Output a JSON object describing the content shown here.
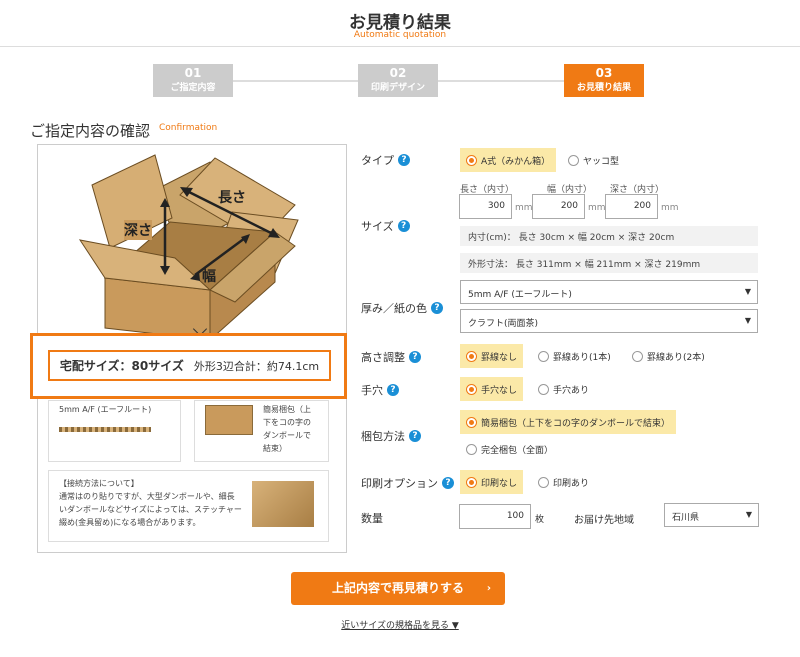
{
  "header": {
    "title": "お見積り結果",
    "subtitle": "Automatic quotation"
  },
  "steps": [
    {
      "num": "01",
      "label": "ご指定内容"
    },
    {
      "num": "02",
      "label": "印刷デザイン"
    },
    {
      "num": "03",
      "label": "お見積り結果"
    }
  ],
  "section": {
    "title": "ご指定内容の確認",
    "subtitle": "Confirmation"
  },
  "diagram": {
    "length": "長さ",
    "depth": "深さ",
    "width": "幅"
  },
  "summary": {
    "size_label": "宅配サイズ：80サイズ",
    "total_label": "外形3辺合計：約74.1cm"
  },
  "cards": {
    "flute": "5mm A/F (エーフルート)",
    "pack_desc": [
      "簡易梱包（上",
      "下をコの字の",
      "ダンボールで",
      "結束）"
    ],
    "bonding_title": "【接続方法について】",
    "bonding_text": [
      "通常はのり貼りですが、大型ダンボールや、細長",
      "いダンボールなどサイズによっては、ステッチャー",
      "綴め(金具留め)になる場合があります。"
    ]
  },
  "form": {
    "type": {
      "label": "タイプ",
      "options": [
        "A式（みかん箱）",
        "ヤッコ型"
      ]
    },
    "size": {
      "label": "サイズ",
      "headers": [
        "長さ（内寸）",
        "幅（内寸）",
        "深さ（内寸）"
      ],
      "values": [
        "300",
        "200",
        "200"
      ],
      "unit": "mm",
      "inner": "内寸(cm)： 長さ 30cm × 幅 20cm × 深さ 20cm",
      "outer": "外形寸法： 長さ 311mm × 幅 211mm × 深さ 219mm"
    },
    "thickness": {
      "label": "厚み／紙の色",
      "flute": "5mm A/F (エーフルート)",
      "color": "クラフト(両面茶)"
    },
    "height": {
      "label": "高さ調整",
      "options": [
        "罫線なし",
        "罫線あり(1本)",
        "罫線あり(2本)"
      ]
    },
    "handhole": {
      "label": "手穴",
      "options": [
        "手穴なし",
        "手穴あり"
      ]
    },
    "packing": {
      "label": "梱包方法",
      "options": [
        "簡易梱包（上下をコの字のダンボールで結束）",
        "完全梱包（全面）"
      ]
    },
    "print": {
      "label": "印刷オプション",
      "options": [
        "印刷なし",
        "印刷あり"
      ]
    },
    "quantity": {
      "label": "数量",
      "value": "100",
      "unit": "枚"
    },
    "destination": {
      "label": "お届け先地域",
      "value": "石川県"
    }
  },
  "cta": {
    "label": "上記内容で再見積りする",
    "arrow": "›"
  },
  "link": "近いサイズの規格品を見る ▼",
  "colors": {
    "accent": "#f07a14",
    "help": "#1a8fd6",
    "highlight": "#fbe9a8"
  }
}
